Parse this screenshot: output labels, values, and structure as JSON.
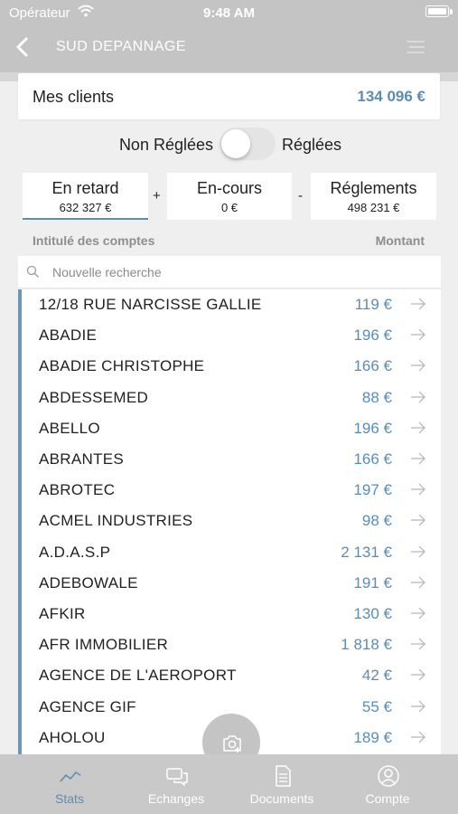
{
  "status_bar": {
    "carrier": "Opérateur",
    "time": "9:48 AM"
  },
  "nav": {
    "title": "SUD DEPANNAGE"
  },
  "clients": {
    "label": "Mes clients",
    "total": "134 096 €"
  },
  "toggle": {
    "left_label": "Non Réglées",
    "right_label": "Réglées",
    "state": "off"
  },
  "summary": {
    "late": {
      "title": "En retard",
      "value": "632 327 €"
    },
    "current": {
      "title": "En-cours",
      "value": "0 €"
    },
    "payments": {
      "title": "Réglements",
      "value": "498 231 €"
    },
    "op_plus": "+",
    "op_minus": "-"
  },
  "list_header": {
    "left": "Intitulé des comptes",
    "right": "Montant"
  },
  "search": {
    "placeholder": "Nouvelle recherche"
  },
  "accounts": [
    {
      "name": "12/18 RUE NARCISSE GALLIE",
      "amount": "119 €"
    },
    {
      "name": "ABADIE",
      "amount": "196 €"
    },
    {
      "name": "ABADIE CHRISTOPHE",
      "amount": "166 €"
    },
    {
      "name": "ABDESSEMED",
      "amount": "88 €"
    },
    {
      "name": "ABELLO",
      "amount": "196 €"
    },
    {
      "name": "ABRANTES",
      "amount": "166 €"
    },
    {
      "name": "ABROTEC",
      "amount": "197 €"
    },
    {
      "name": "ACMEL INDUSTRIES",
      "amount": "98 €"
    },
    {
      "name": "A.D.A.S.P",
      "amount": "2 131 €"
    },
    {
      "name": "ADEBOWALE",
      "amount": "191 €"
    },
    {
      "name": "AFKIR",
      "amount": "130 €"
    },
    {
      "name": "AFR IMMOBILIER",
      "amount": "1 818 €"
    },
    {
      "name": "AGENCE DE L'AEROPORT",
      "amount": "42 €"
    },
    {
      "name": "AGENCE GIF",
      "amount": "55 €"
    },
    {
      "name": "AHOLOU",
      "amount": "189 €"
    }
  ],
  "tabs": [
    {
      "label": "Stats",
      "icon": "chart-line-icon",
      "active": true
    },
    {
      "label": "Echanges",
      "icon": "chat-icon",
      "active": false
    },
    {
      "label": "Documents",
      "icon": "document-icon",
      "active": false
    },
    {
      "label": "Compte",
      "icon": "user-icon",
      "active": false
    }
  ],
  "colors": {
    "accent": "#5b8db3",
    "header": "#c4c4c4",
    "tabbar": "#c9c9c9"
  }
}
